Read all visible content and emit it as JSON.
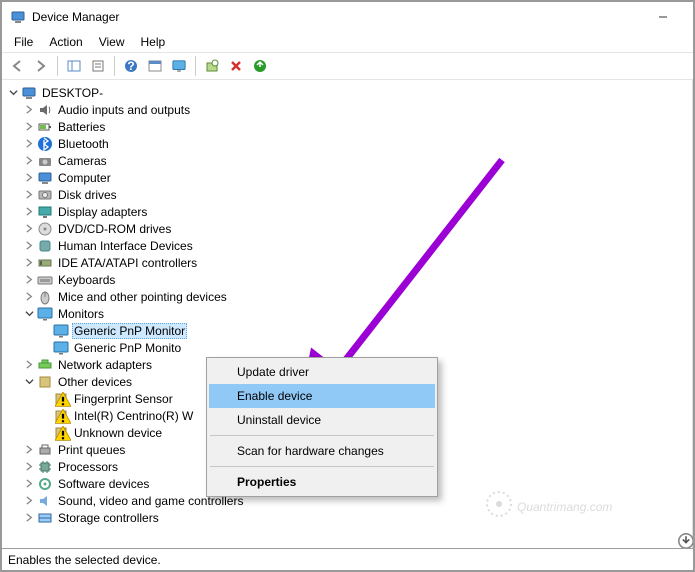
{
  "window": {
    "title": "Device Manager"
  },
  "menubar": {
    "file": "File",
    "action": "Action",
    "view": "View",
    "help": "Help"
  },
  "toolbar_names": {
    "back": "back-icon",
    "forward": "forward-icon",
    "show": "show-hidden-icon",
    "props": "properties-icon",
    "help": "help-icon",
    "console": "console-icon",
    "monitor": "remote-icon",
    "wizard": "add-hardware-icon",
    "delete": "delete-icon",
    "refresh": "refresh-icon"
  },
  "tree": {
    "root": "DESKTOP-",
    "items": [
      {
        "label": "Audio inputs and outputs",
        "icon": "audio"
      },
      {
        "label": "Batteries",
        "icon": "battery"
      },
      {
        "label": "Bluetooth",
        "icon": "bluetooth"
      },
      {
        "label": "Cameras",
        "icon": "camera"
      },
      {
        "label": "Computer",
        "icon": "computer"
      },
      {
        "label": "Disk drives",
        "icon": "disk"
      },
      {
        "label": "Display adapters",
        "icon": "display"
      },
      {
        "label": "DVD/CD-ROM drives",
        "icon": "dvd"
      },
      {
        "label": "Human Interface Devices",
        "icon": "hid"
      },
      {
        "label": "IDE ATA/ATAPI controllers",
        "icon": "ide"
      },
      {
        "label": "Keyboards",
        "icon": "keyboard"
      },
      {
        "label": "Mice and other pointing devices",
        "icon": "mouse"
      },
      {
        "label": "Monitors",
        "icon": "monitor",
        "expanded": true,
        "children": [
          {
            "label": "Generic PnP Monitor",
            "icon": "monitor",
            "selected": true,
            "disabled": true
          },
          {
            "label": "Generic PnP Monito",
            "icon": "monitor"
          }
        ]
      },
      {
        "label": "Network adapters",
        "icon": "network"
      },
      {
        "label": "Other devices",
        "icon": "other",
        "expanded": true,
        "children": [
          {
            "label": "Fingerprint Sensor",
            "icon": "other",
            "warn": true
          },
          {
            "label": "Intel(R) Centrino(R) W",
            "icon": "other",
            "warn": true,
            "clipped": true
          },
          {
            "label": "Unknown device",
            "icon": "other",
            "warn": true
          }
        ]
      },
      {
        "label": "Print queues",
        "icon": "printer"
      },
      {
        "label": "Processors",
        "icon": "cpu"
      },
      {
        "label": "Software devices",
        "icon": "software"
      },
      {
        "label": "Sound, video and game controllers",
        "icon": "sound"
      },
      {
        "label": "Storage controllers",
        "icon": "storage",
        "cutoff": true
      }
    ]
  },
  "context_menu": {
    "items": [
      {
        "label": "Update driver"
      },
      {
        "label": "Enable device",
        "highlight": true
      },
      {
        "label": "Uninstall device"
      },
      {
        "sep": true
      },
      {
        "label": "Scan for hardware changes"
      },
      {
        "sep": true
      },
      {
        "label": "Properties",
        "bold": true
      }
    ]
  },
  "statusbar": "Enables the selected device.",
  "watermark": "Quantrimang.com",
  "colors": {
    "select_bg": "#cde8ff",
    "menu_hl": "#90c8f6",
    "arrow": "#9b00d4"
  }
}
